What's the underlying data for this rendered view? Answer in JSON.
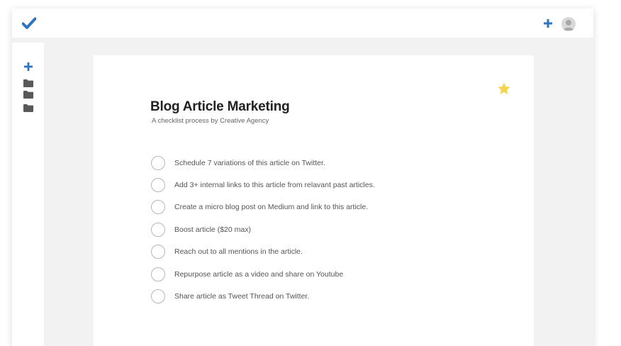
{
  "colors": {
    "accent": "#2f74c0",
    "star": "#f2d54c",
    "folder": "#595959"
  },
  "header": {
    "logo_icon": "checkmark-icon",
    "add_icon": "plus-icon",
    "avatar_icon": "user-avatar-icon"
  },
  "sidebar": {
    "add_icon": "plus-icon",
    "folders": [
      "folder-icon",
      "folder-icon",
      "folder-icon"
    ]
  },
  "checklist": {
    "title": "Blog Article Marketing",
    "subtitle": "A checklist process by Creative Agency",
    "favorite_icon": "star-icon",
    "items": [
      {
        "label": "Schedule 7 variations of this article on Twitter."
      },
      {
        "label": "Add 3+ internal links to this article from relavant past articles."
      },
      {
        "label": "Create a micro blog post on Medium and link to this article."
      },
      {
        "label": "Boost article ($20 max)"
      },
      {
        "label": "Reach out to all mentions in the article."
      },
      {
        "label": "Repurpose article as a video and share on Youtube"
      },
      {
        "label": "Share article as Tweet Thread on Twitter."
      }
    ]
  }
}
